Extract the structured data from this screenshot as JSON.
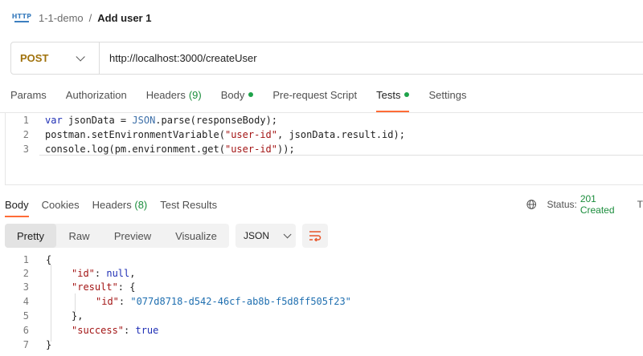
{
  "breadcrumb": {
    "icon": "http-request-icon",
    "icon_text": "HTTP",
    "parent": "1-1-demo",
    "separator": "/",
    "current": "Add user 1"
  },
  "request": {
    "method": "POST",
    "url": "http://localhost:3000/createUser",
    "tabs": [
      {
        "label": "Params"
      },
      {
        "label": "Authorization"
      },
      {
        "label": "Headers",
        "count": "(9)"
      },
      {
        "label": "Body",
        "dot": true
      },
      {
        "label": "Pre-request Script"
      },
      {
        "label": "Tests",
        "dot": true,
        "active": true
      },
      {
        "label": "Settings"
      }
    ]
  },
  "script": {
    "lines": [
      {
        "n": "1",
        "text": "var jsonData = JSON.parse(responseBody);"
      },
      {
        "n": "2",
        "text": "postman.setEnvironmentVariable(\"user-id\", jsonData.result.id);"
      },
      {
        "n": "3",
        "text": "console.log(pm.environment.get(\"user-id\"));"
      }
    ]
  },
  "response": {
    "tabs": [
      {
        "label": "Body",
        "active": true
      },
      {
        "label": "Cookies"
      },
      {
        "label": "Headers",
        "count": "(8)"
      },
      {
        "label": "Test Results"
      }
    ],
    "status_label": "Status:",
    "status_value": "201 Created",
    "status_more": "T",
    "views": [
      "Pretty",
      "Raw",
      "Preview",
      "Visualize"
    ],
    "active_view": "Pretty",
    "format": "JSON",
    "body_lines": [
      {
        "n": "1",
        "text": "{"
      },
      {
        "n": "2",
        "text": "\"id\": null,"
      },
      {
        "n": "3",
        "text": "\"result\": {"
      },
      {
        "n": "4",
        "text": "\"id\": \"077d8718-d542-46cf-ab8b-f5d8ff505f23\""
      },
      {
        "n": "5",
        "text": "},"
      },
      {
        "n": "6",
        "text": "\"success\": true"
      },
      {
        "n": "7",
        "text": "}"
      }
    ]
  },
  "colors": {
    "accent": "#ff6c37",
    "method": "#a0720c",
    "status_ok": "#1b8d3c",
    "dot": "#1ea34a"
  }
}
